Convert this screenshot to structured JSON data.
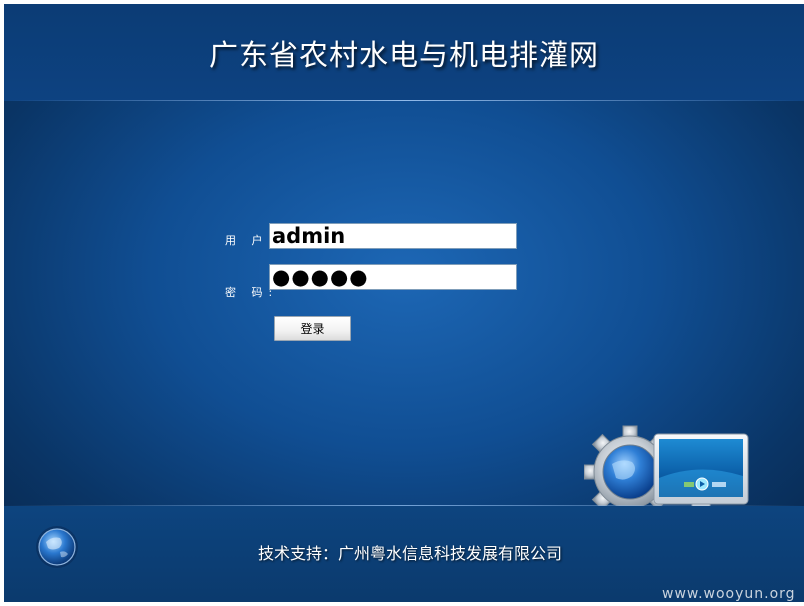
{
  "header": {
    "title": "广东省农村水电与机电排灌网"
  },
  "login": {
    "username_label": "用 户",
    "password_label": "密 码",
    "label_colon": ":",
    "username_value": "admin",
    "password_value": "●●●●●",
    "submit_label": "登录"
  },
  "footer": {
    "support_text": "技术支持：广州粤水信息科技发展有限公司"
  },
  "watermark": "www.wooyun.org",
  "icons": [
    "globe-icon",
    "computer-gear-icon"
  ],
  "colors": {
    "background": "#104e93",
    "header": "#0c3c75",
    "text": "#ffffff"
  }
}
